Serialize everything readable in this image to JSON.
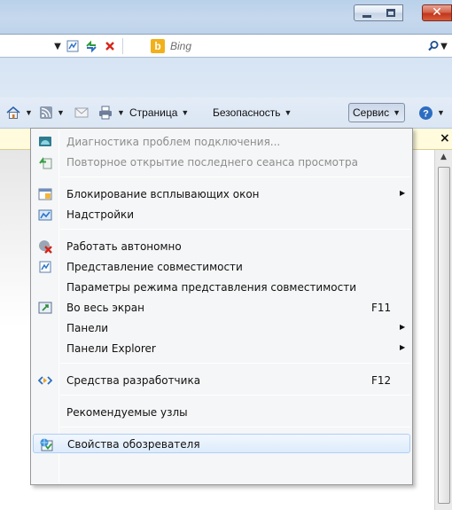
{
  "window": {
    "buttons": [
      "minimize",
      "maximize",
      "close"
    ],
    "close_glyph": "✕"
  },
  "addressbar": {
    "tools": [
      "dropdown-arrow",
      "compat-view-icon",
      "refresh-icon",
      "stop-icon"
    ],
    "search_placeholder": "Bing",
    "search_logo": "b"
  },
  "commandbar": {
    "page_label": "Страница",
    "safety_label": "Безопасность",
    "tools_label": "Сервис"
  },
  "infobar": {
    "close_glyph": "×"
  },
  "menu": {
    "items": [
      {
        "label": "Диагностика проблем подключения...",
        "disabled": true,
        "icon": "network-diagnostics-icon"
      },
      {
        "label": "Повторное открытие последнего сеанса просмотра",
        "disabled": true,
        "icon": "reopen-session-icon"
      },
      {
        "label": "Блокирование всплывающих окон",
        "submenu": true,
        "icon": "popup-blocker-icon"
      },
      {
        "label": "Надстройки",
        "icon": "addons-icon"
      },
      {
        "label": "Работать автономно",
        "icon": "work-offline-icon"
      },
      {
        "label": "Представление совместимости",
        "icon": "compat-view-icon"
      },
      {
        "label": "Параметры режима представления совместимости"
      },
      {
        "label": "Во весь экран",
        "shortcut": "F11",
        "icon": "fullscreen-icon"
      },
      {
        "label": "Панели",
        "submenu": true
      },
      {
        "label": "Панели Explorer",
        "submenu": true
      },
      {
        "label": "Средства разработчика",
        "shortcut": "F12",
        "icon": "dev-tools-icon"
      },
      {
        "label": "Рекомендуемые узлы"
      },
      {
        "label": "Свойства обозревателя",
        "icon": "internet-options-icon",
        "highlighted": true
      }
    ]
  },
  "colors": {
    "title_bar": "#c6d8ed",
    "menu_bg": "#f5f6f7",
    "highlight": "#dcebfc",
    "disabled_text": "#8d8d8d",
    "infobar": "#fffbdc"
  }
}
